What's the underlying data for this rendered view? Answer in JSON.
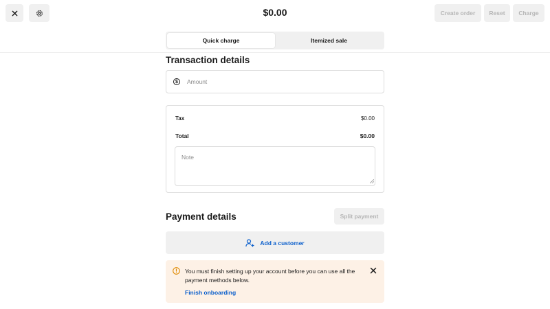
{
  "header": {
    "close_icon": "close-icon",
    "settings_icon": "gear-icon",
    "amount": "$0.00",
    "create_order_label": "Create order",
    "reset_label": "Reset",
    "charge_label": "Charge"
  },
  "tabs": [
    {
      "label": "Quick charge",
      "active": true
    },
    {
      "label": "Itemized sale",
      "active": false
    }
  ],
  "transaction": {
    "title": "Transaction details",
    "amount_placeholder": "Amount",
    "tax_label": "Tax",
    "tax_value": "$0.00",
    "total_label": "Total",
    "total_value": "$0.00",
    "note_placeholder": "Note"
  },
  "payment": {
    "title": "Payment details",
    "split_label": "Split payment",
    "add_customer_label": "Add a customer",
    "alert_message": "You must finish setting up your account before you can use all the payment methods below.",
    "alert_link": "Finish onboarding"
  },
  "colors": {
    "accent": "#0b5fcc",
    "alert_bg": "#fdf1e6",
    "warning": "#e08a00",
    "disabled_text": "#b5b5b5"
  }
}
